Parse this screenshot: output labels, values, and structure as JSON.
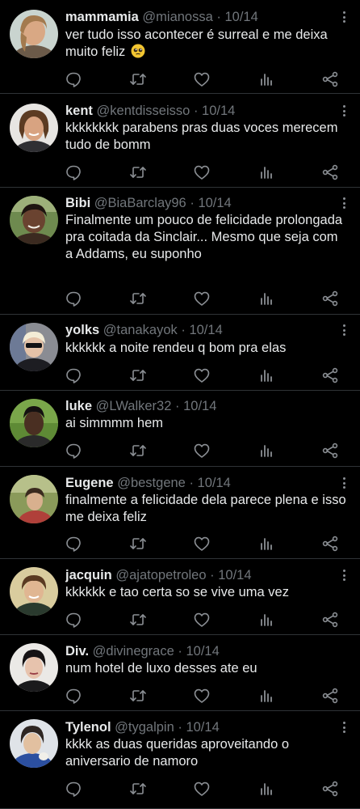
{
  "tweets": [
    {
      "name": "mammamia",
      "handle": "@mianossa",
      "date": "10/14",
      "text": "ver tudo isso acontecer é surreal e me deixa muito feliz",
      "emoji": "pleading-face-emoji"
    },
    {
      "name": "kent",
      "handle": "@kentdisseisso",
      "date": "10/14",
      "text": "kkkkkkkk parabens pras duas voces merecem tudo de bomm"
    },
    {
      "name": "Bibi",
      "handle": "@BiaBarclay96",
      "date": "10/14",
      "text": "Finalmente um pouco de felicidade prolongada pra coitada da Sinclair... Mesmo que seja com a Addams, eu suponho"
    },
    {
      "name": "yolks",
      "handle": "@tanakayok",
      "date": "10/14",
      "text": "kkkkkk a noite rendeu q bom pra elas"
    },
    {
      "name": "luke",
      "handle": "@LWalker32",
      "date": "10/14",
      "text": "ai simmmm hem"
    },
    {
      "name": "Eugene",
      "handle": "@bestgene",
      "date": "10/14",
      "text": "finalmente a felicidade dela parece plena e isso me deixa feliz"
    },
    {
      "name": "jacquin",
      "handle": "@ajatopetroleo",
      "date": "10/14",
      "text": "kkkkkk e tao certa so se vive uma vez"
    },
    {
      "name": "Div.",
      "handle": "@divinegrace",
      "date": "10/14",
      "text": "num hotel de luxo desses ate eu"
    },
    {
      "name": "Tylenol",
      "handle": "@tygalpin",
      "date": "10/14",
      "text": "kkkk as duas queridas aproveitando o aniversario de namoro"
    }
  ],
  "separator": "·",
  "icons": {
    "reply": "reply-icon",
    "retweet": "retweet-icon",
    "like": "like-icon",
    "views": "views-icon",
    "share": "share-icon",
    "more": "more-options-icon"
  },
  "colors": {
    "background": "#000000",
    "text": "#e7e9ea",
    "secondary": "#71767b",
    "divider": "#2f3336"
  }
}
